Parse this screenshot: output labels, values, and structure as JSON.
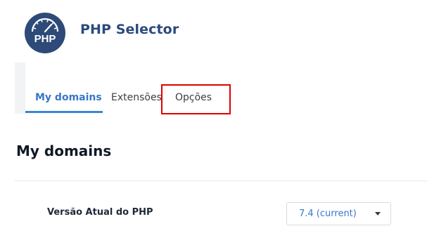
{
  "header": {
    "logo_text": "PHP",
    "app_title": "PHP Selector"
  },
  "tabs": [
    {
      "label": "My domains",
      "active": true
    },
    {
      "label": "Extensões",
      "active": false
    },
    {
      "label": "Opções",
      "active": false
    }
  ],
  "section": {
    "title": "My domains",
    "setting_label": "Versão Atual do PHP",
    "php_version_selected": "7.4 (current)"
  },
  "colors": {
    "brand": "#2b4b7c",
    "accent": "#3a86d6",
    "highlight": "#e00000"
  }
}
